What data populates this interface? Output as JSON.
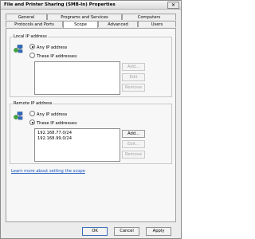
{
  "window": {
    "title": "File and Printer Sharing (SMB-In) Properties",
    "close_label": "✕"
  },
  "tabs_row1": [
    "General",
    "Programs and Services",
    "Computers"
  ],
  "tabs_row2": [
    "Protocols and Ports",
    "Scope",
    "Advanced",
    "Users"
  ],
  "active_tab": "Scope",
  "local": {
    "label": "Local IP address",
    "option_any": "Any IP address",
    "option_these": "These IP addresses:",
    "selected": "any",
    "addresses": [],
    "buttons": {
      "add": "Add...",
      "edit": "Edit",
      "remove": "Remove"
    }
  },
  "remote": {
    "label": "Remote IP address",
    "option_any": "Any IP address",
    "option_these": "These IP addresses:",
    "selected": "these",
    "addresses": [
      "192.168.77.0/24",
      "192.168.99.0/24"
    ],
    "buttons": {
      "add": "Add...",
      "edit": "Edit...",
      "remove": "Remove"
    }
  },
  "learn_more": "Learn more about setting the scope",
  "footer": {
    "ok": "OK",
    "cancel": "Cancel",
    "apply": "Apply"
  },
  "colors": {
    "link": "#1a56c0",
    "monitor_blue": "#2d6fc2",
    "globe_green": "#3fa63f"
  },
  "icons": [
    "network-computers-icon",
    "close-icon"
  ]
}
